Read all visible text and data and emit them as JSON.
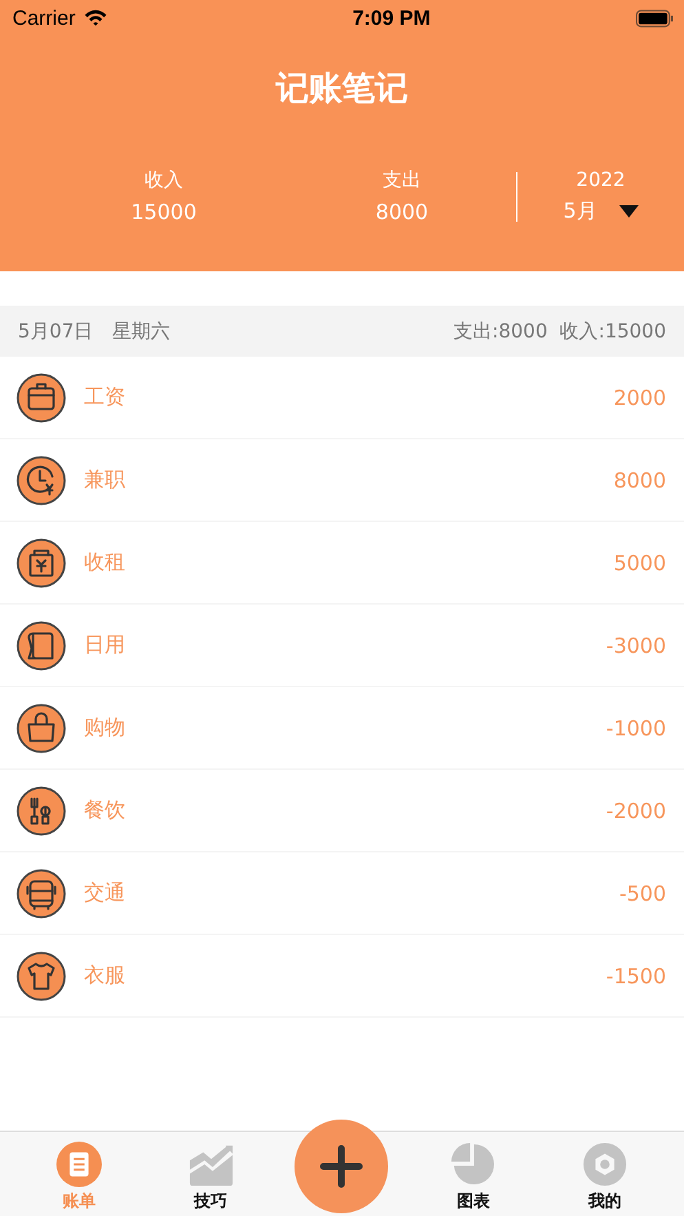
{
  "status_bar": {
    "carrier": "Carrier",
    "time": "7:09 PM"
  },
  "title": "记账笔记",
  "summary": {
    "income_label": "收入",
    "income": "15000",
    "expense_label": "支出",
    "expense": "8000",
    "year": "2022",
    "month": "5月"
  },
  "day": {
    "date": "5月07日",
    "weekday": "星期六",
    "totals": "支出:8000  收入:15000"
  },
  "entries": [
    {
      "name": "工资",
      "amount": "2000"
    },
    {
      "name": "兼职",
      "amount": "8000"
    },
    {
      "name": "收租",
      "amount": "5000"
    },
    {
      "name": "日用",
      "amount": "-3000"
    },
    {
      "name": "购物",
      "amount": "-1000"
    },
    {
      "name": "餐饮",
      "amount": "-2000"
    },
    {
      "name": "交通",
      "amount": "-500"
    },
    {
      "name": "衣服",
      "amount": "-1500"
    }
  ],
  "tabs": [
    {
      "kind": "tab",
      "label": "账单",
      "selected": true
    },
    {
      "kind": "tab",
      "label": "技巧",
      "selected": false
    },
    {
      "kind": "add"
    },
    {
      "kind": "tab",
      "label": "图表",
      "selected": false
    },
    {
      "kind": "tab",
      "label": "我的",
      "selected": false
    }
  ]
}
